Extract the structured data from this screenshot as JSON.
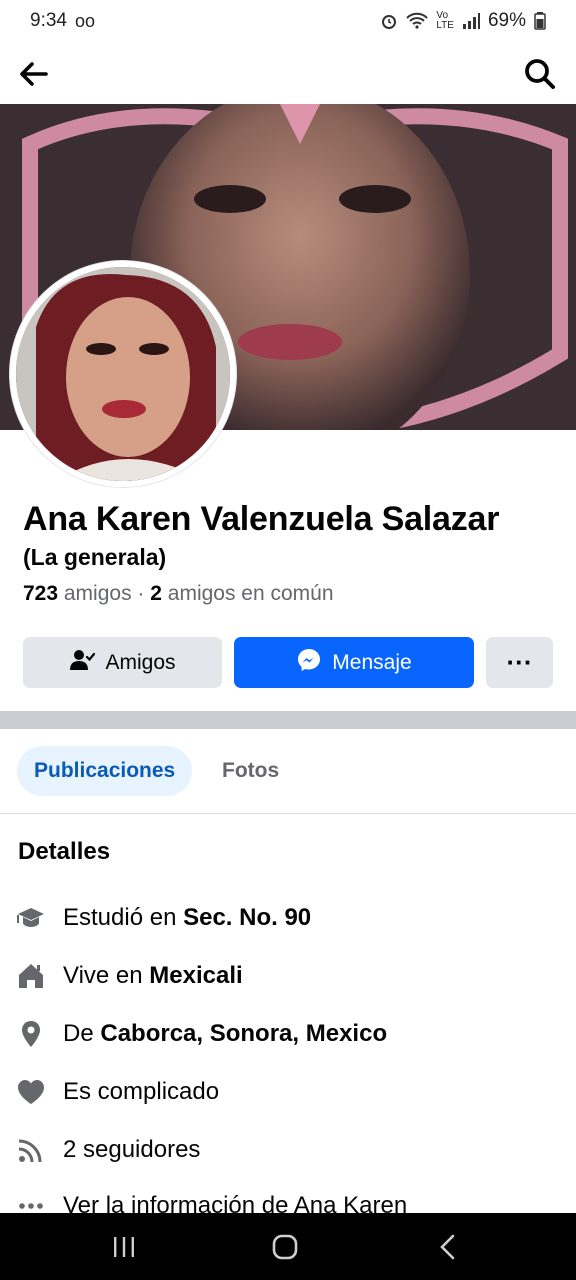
{
  "status": {
    "time": "9:34",
    "battery": "69%"
  },
  "profile": {
    "name": "Ana Karen Valenzuela Salazar",
    "alt_name": "(La generala)",
    "friends_count": "723",
    "friends_label": " amigos",
    "separator": " · ",
    "mutual_count": "2",
    "mutual_label": " amigos en común"
  },
  "actions": {
    "friends_label": "Amigos",
    "message_label": "Mensaje",
    "more_label": "···"
  },
  "tabs": [
    {
      "label": "Publicaciones",
      "active": true
    },
    {
      "label": "Fotos",
      "active": false
    }
  ],
  "details": {
    "title": "Detalles",
    "items": [
      {
        "icon": "graduation-cap-icon",
        "prefix": "Estudió en ",
        "bold": "Sec. No. 90"
      },
      {
        "icon": "home-icon",
        "prefix": "Vive en ",
        "bold": "Mexicali"
      },
      {
        "icon": "location-pin-icon",
        "prefix": "De ",
        "bold": "Caborca, Sonora, Mexico"
      },
      {
        "icon": "heart-icon",
        "prefix": "Es complicado",
        "bold": ""
      },
      {
        "icon": "rss-followers-icon",
        "prefix": "2 seguidores",
        "bold": ""
      },
      {
        "icon": "more-dots-icon",
        "prefix": "Ver la información de Ana Karen",
        "bold": ""
      }
    ]
  },
  "colors": {
    "brand_blue": "#0866ff",
    "tab_active_bg": "#e7f3ff",
    "tab_active_text": "#0a5ab7",
    "secondary_text": "#65676b"
  }
}
